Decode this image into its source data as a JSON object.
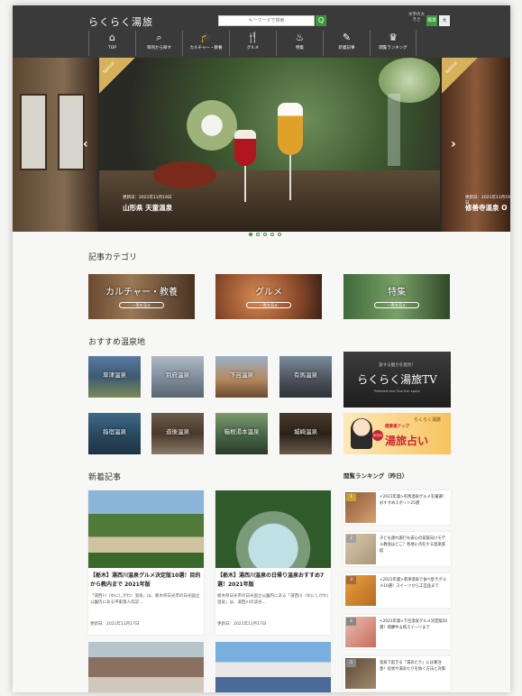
{
  "header": {
    "logo": "らくらく湯旅",
    "search_placeholder": "キーワードで検索",
    "search_button": "Q",
    "font_size_label": "文字の大きさ",
    "font_standard": "標準",
    "font_large": "大",
    "nav": [
      {
        "icon": "⌂",
        "label": "TOP"
      },
      {
        "icon": "⌕",
        "label": "目的から探す"
      },
      {
        "icon": "🎓",
        "label": "カルチャー・教養"
      },
      {
        "icon": "🍴",
        "label": "グルメ"
      },
      {
        "icon": "♨",
        "label": "特集"
      },
      {
        "icon": "✎",
        "label": "新着記事"
      },
      {
        "icon": "♛",
        "label": "閲覧ランキング"
      }
    ]
  },
  "carousel": {
    "badge": "Special",
    "main": {
      "date": "更新日：2021年11月19日",
      "title": "山形県 天童温泉"
    },
    "next": {
      "date": "更新日：2021年11月19日",
      "title": "修善寺温泉 O"
    },
    "prev_arrow": "‹",
    "next_arrow": "›",
    "active_dot": 0,
    "dot_count": 5
  },
  "categories": {
    "title": "記事カテゴリ",
    "items": [
      {
        "label": "カルチャー・教養",
        "button": "一覧を見る"
      },
      {
        "label": "グルメ",
        "button": "一覧を見る"
      },
      {
        "label": "特集",
        "button": "一覧を見る"
      }
    ]
  },
  "recommended": {
    "title": "おすすめ温泉地",
    "items": [
      "草津温泉",
      "別府温泉",
      "下呂温泉",
      "有馬温泉",
      "指宿温泉",
      "道後温泉",
      "箱根湯本温泉",
      "城崎温泉"
    ]
  },
  "tv_banner": {
    "small": "旅する魅力を発見！",
    "title": "らくらく湯旅TV",
    "sub": "Relaxed and Tourism spots"
  },
  "fortune_banner": {
    "brand": "らくらく湯旅",
    "sub": "健康運アップ",
    "tag": "今日の",
    "title": "湯旅占い"
  },
  "new_articles": {
    "title": "新着記事",
    "items": [
      {
        "title": "【栃木】湯西川温泉グルメ決定版10選！目的から教内まで 2021年版",
        "excerpt": "「湯西川（ゆにしがわ）温泉」は、栃木県日光市の日光国立公園内にある平家落人伝説...",
        "date": "更新日：2021年11月17日"
      },
      {
        "title": "【栃木】湯西川温泉の日帰り温泉おすすめ7選！2021年版",
        "excerpt": "栃木県日光市の日光国立公園内にある「湯西川（ゆにしがわ）温泉」は、湯西川の渓谷...",
        "date": "更新日：2021年11月17日"
      }
    ]
  },
  "ranking": {
    "title": "閲覧ランキング（昨日）",
    "items": [
      {
        "rank": "1",
        "text": "<2021年版>有馬温泉グルメを厳選！おすすめスポット25選"
      },
      {
        "rank": "2",
        "text": "子ども連れ旅行も安心の家族向けモデル教会はどこ？各地に点在する温泉旅館"
      },
      {
        "rank": "3",
        "text": "<2021年版>草津温泉で食べ歩きグルメ10選！スイーツから工芸品まで"
      },
      {
        "rank": "4",
        "text": "<2021年版>下呂温泉グルメ決定版20選！飛騨牛＆和スイーツまで"
      },
      {
        "rank": "5",
        "text": "温泉で起きる「湯あたり」には要注意！症状や湯あたりを防ぐ方法と対策"
      }
    ]
  }
}
